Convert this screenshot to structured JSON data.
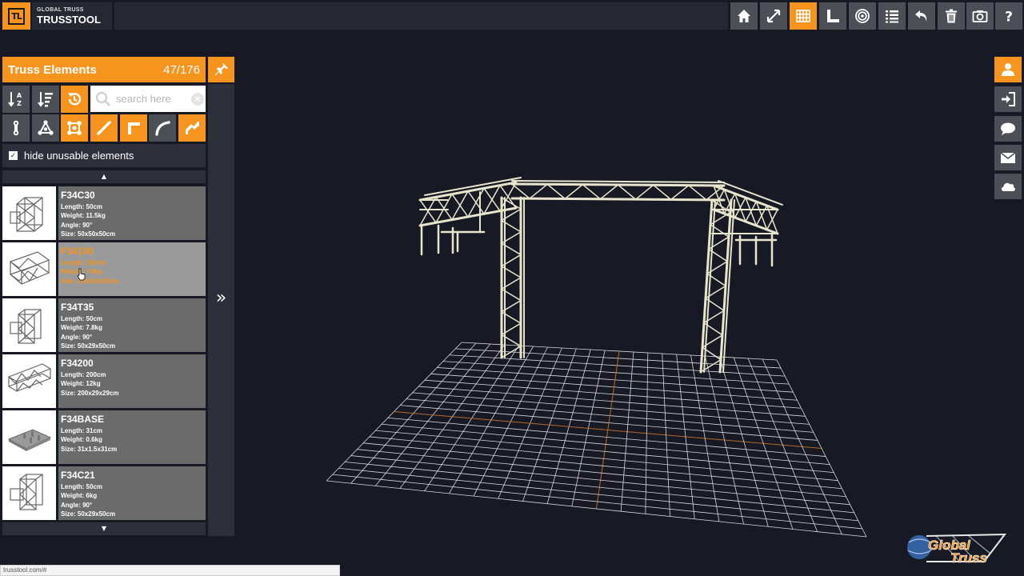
{
  "app": {
    "logo_text": "TL",
    "brand_small": "GLOBAL TRUSS",
    "brand_name": "TRUSSTOOL",
    "toolbar": [
      "home-icon",
      "fullscreen-icon",
      "grid-icon",
      "ruler-icon",
      "target-icon",
      "list-icon",
      "undo-icon",
      "trash-icon",
      "camera-icon",
      "help-icon"
    ],
    "active_tool": "grid-icon"
  },
  "panel": {
    "title": "Truss Elements",
    "count": "47/176",
    "search_placeholder": "search here",
    "hide_label": "hide unusable elements",
    "hide_checked": true,
    "sort_buttons": [
      "sort-alpha-icon",
      "sort-size-icon",
      "reset-icon"
    ],
    "filter_buttons": [
      "connector-icon",
      "triangle-truss-icon",
      "square-truss-icon",
      "straight-icon",
      "corner-icon",
      "curve-icon",
      "special-icon"
    ]
  },
  "elements": [
    {
      "name": "F34C30",
      "l1": "Length: 50cm",
      "l2": "Weight: 11.5kg",
      "l3": "Angle: 90°",
      "l4": "Size: 50x50x50cm"
    },
    {
      "name": "F34100",
      "l1": "Length: 100cm",
      "l2": "Weight: 7.4kg",
      "l3": "Size: 100x29x29cm",
      "l4": ""
    },
    {
      "name": "F34T35",
      "l1": "Length: 50cm",
      "l2": "Weight: 7.8kg",
      "l3": "Angle: 90°",
      "l4": "Size: 50x29x50cm"
    },
    {
      "name": "F34200",
      "l1": "Length: 200cm",
      "l2": "Weight: 12kg",
      "l3": "Size: 200x29x29cm",
      "l4": ""
    },
    {
      "name": "F34BASE",
      "l1": "Length: 31cm",
      "l2": "Weight: 0.6kg",
      "l3": "Size: 31x1.5x31cm",
      "l4": ""
    },
    {
      "name": "F34C21",
      "l1": "Length: 50cm",
      "l2": "Weight: 6kg",
      "l3": "Angle: 90°",
      "l4": "Size: 50x29x50cm"
    }
  ],
  "right_buttons": [
    "user-icon",
    "login-icon",
    "chat-icon",
    "mail-icon",
    "cloud-icon"
  ],
  "status_url": "trusstool.com/#",
  "watermark": "Global Truss",
  "colors": {
    "accent": "#f7941d",
    "background": "#171a25",
    "panel": "#2d303a",
    "button": "#4d4f57"
  }
}
